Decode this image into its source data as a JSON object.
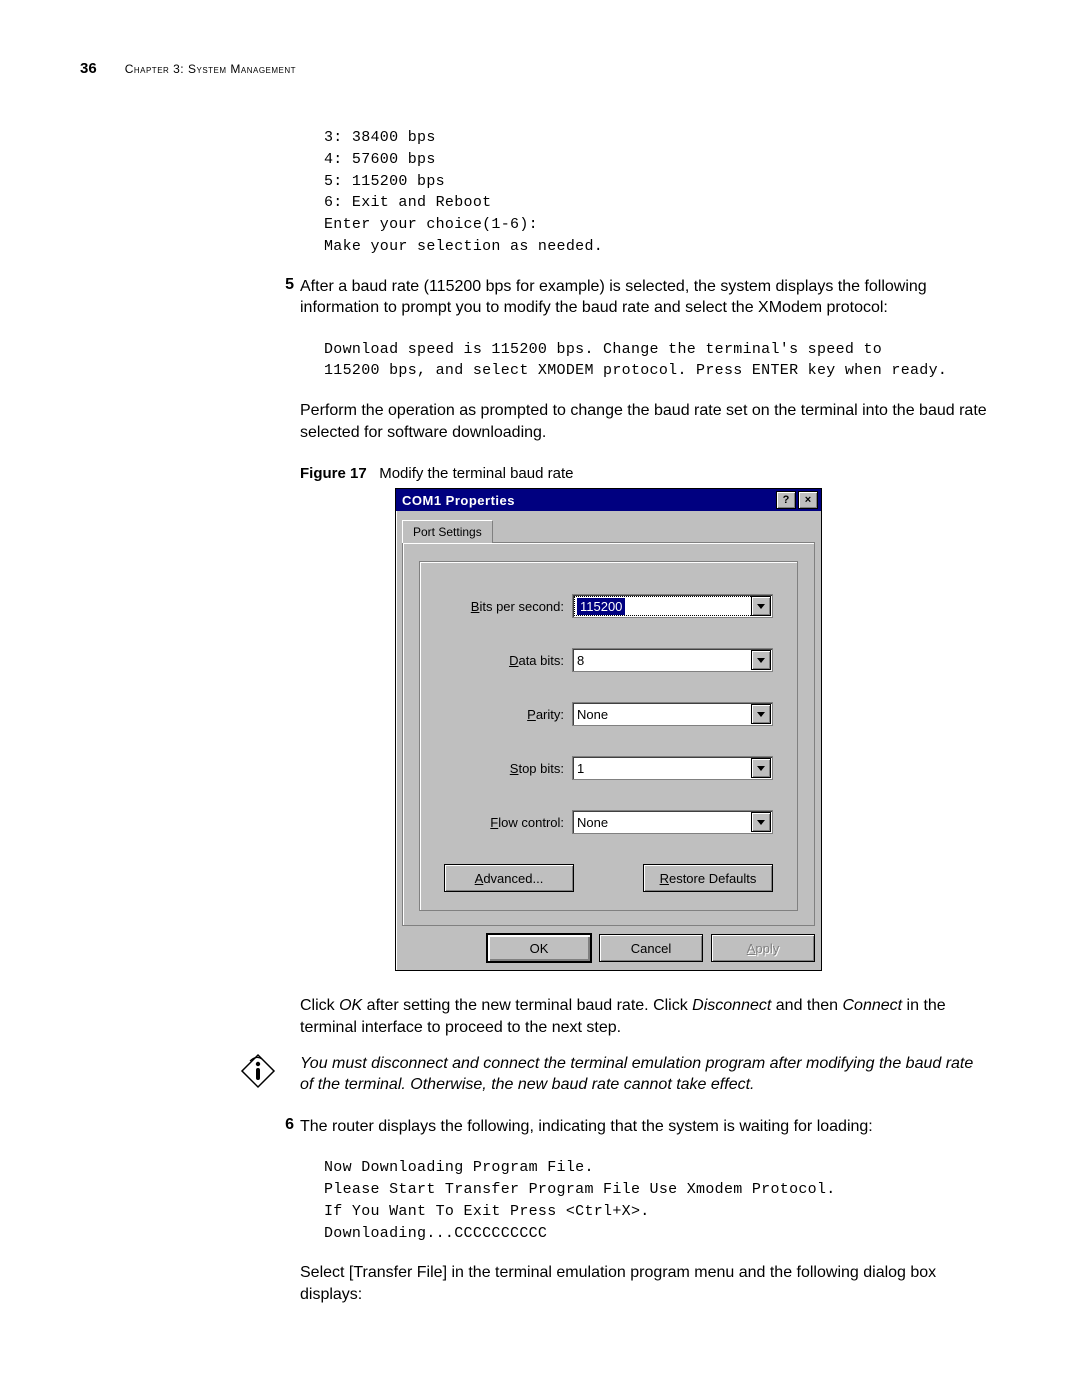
{
  "header": {
    "page_number": "36",
    "chapter_label": "Chapter 3: System Management"
  },
  "block1_code": "3: 38400 bps\n4: 57600 bps\n5: 115200 bps\n6: Exit and Reboot\nEnter your choice(1-6):\nMake your selection as needed.",
  "step5": {
    "num": "5",
    "text": "After a baud rate (115200 bps for example) is selected, the system displays the following information to prompt you to modify the baud rate and select the XModem protocol:"
  },
  "block2_code": "Download speed is 115200 bps. Change the terminal's speed to\n115200 bps, and select XMODEM protocol. Press ENTER key when ready.",
  "para_perform": "Perform the operation as prompted to change the baud rate set on the terminal into the baud rate selected for software downloading.",
  "figure": {
    "label": "Figure 17",
    "caption": "Modify the terminal baud rate"
  },
  "dialog": {
    "title": "COM1 Properties",
    "tab": "Port Settings",
    "fields": {
      "bits_per_second": {
        "label_pre": "B",
        "label_rest": "its per second:",
        "value": "115200",
        "focused": true
      },
      "data_bits": {
        "label_pre": "D",
        "label_rest": "ata bits:",
        "value": "8"
      },
      "parity": {
        "label_pre": "P",
        "label_rest": "arity:",
        "value": "None"
      },
      "stop_bits": {
        "label_pre": "S",
        "label_rest": "top bits:",
        "value": "1"
      },
      "flow_control": {
        "label_pre": "F",
        "label_rest": "low control:",
        "value": "None"
      }
    },
    "advanced": {
      "pre": "A",
      "rest": "dvanced..."
    },
    "restore": {
      "pre": "R",
      "rest": "estore Defaults"
    },
    "ok": "OK",
    "cancel": "Cancel",
    "apply": {
      "pre": "A",
      "rest": "pply"
    }
  },
  "after_dialog": {
    "click": "Click ",
    "ok_italic": "OK",
    "mid1": " after setting the new terminal baud rate. Click ",
    "disconnect_italic": "Disconnect",
    "mid2": " and then ",
    "connect_italic": "Connect",
    "end": " in the terminal interface to proceed to the next step."
  },
  "info_note": "You must disconnect and connect the terminal emulation program after modifying the baud rate of the terminal. Otherwise, the new baud rate cannot take effect.",
  "step6": {
    "num": "6",
    "text": "The router displays the following, indicating that the system is waiting for loading:"
  },
  "block3_code": "Now Downloading Program File.\nPlease Start Transfer Program File Use Xmodem Protocol.\nIf You Want To Exit Press <Ctrl+X>.\nDownloading...CCCCCCCCCC",
  "para_select": "Select [Transfer File] in the terminal emulation program menu and the following dialog box displays:"
}
